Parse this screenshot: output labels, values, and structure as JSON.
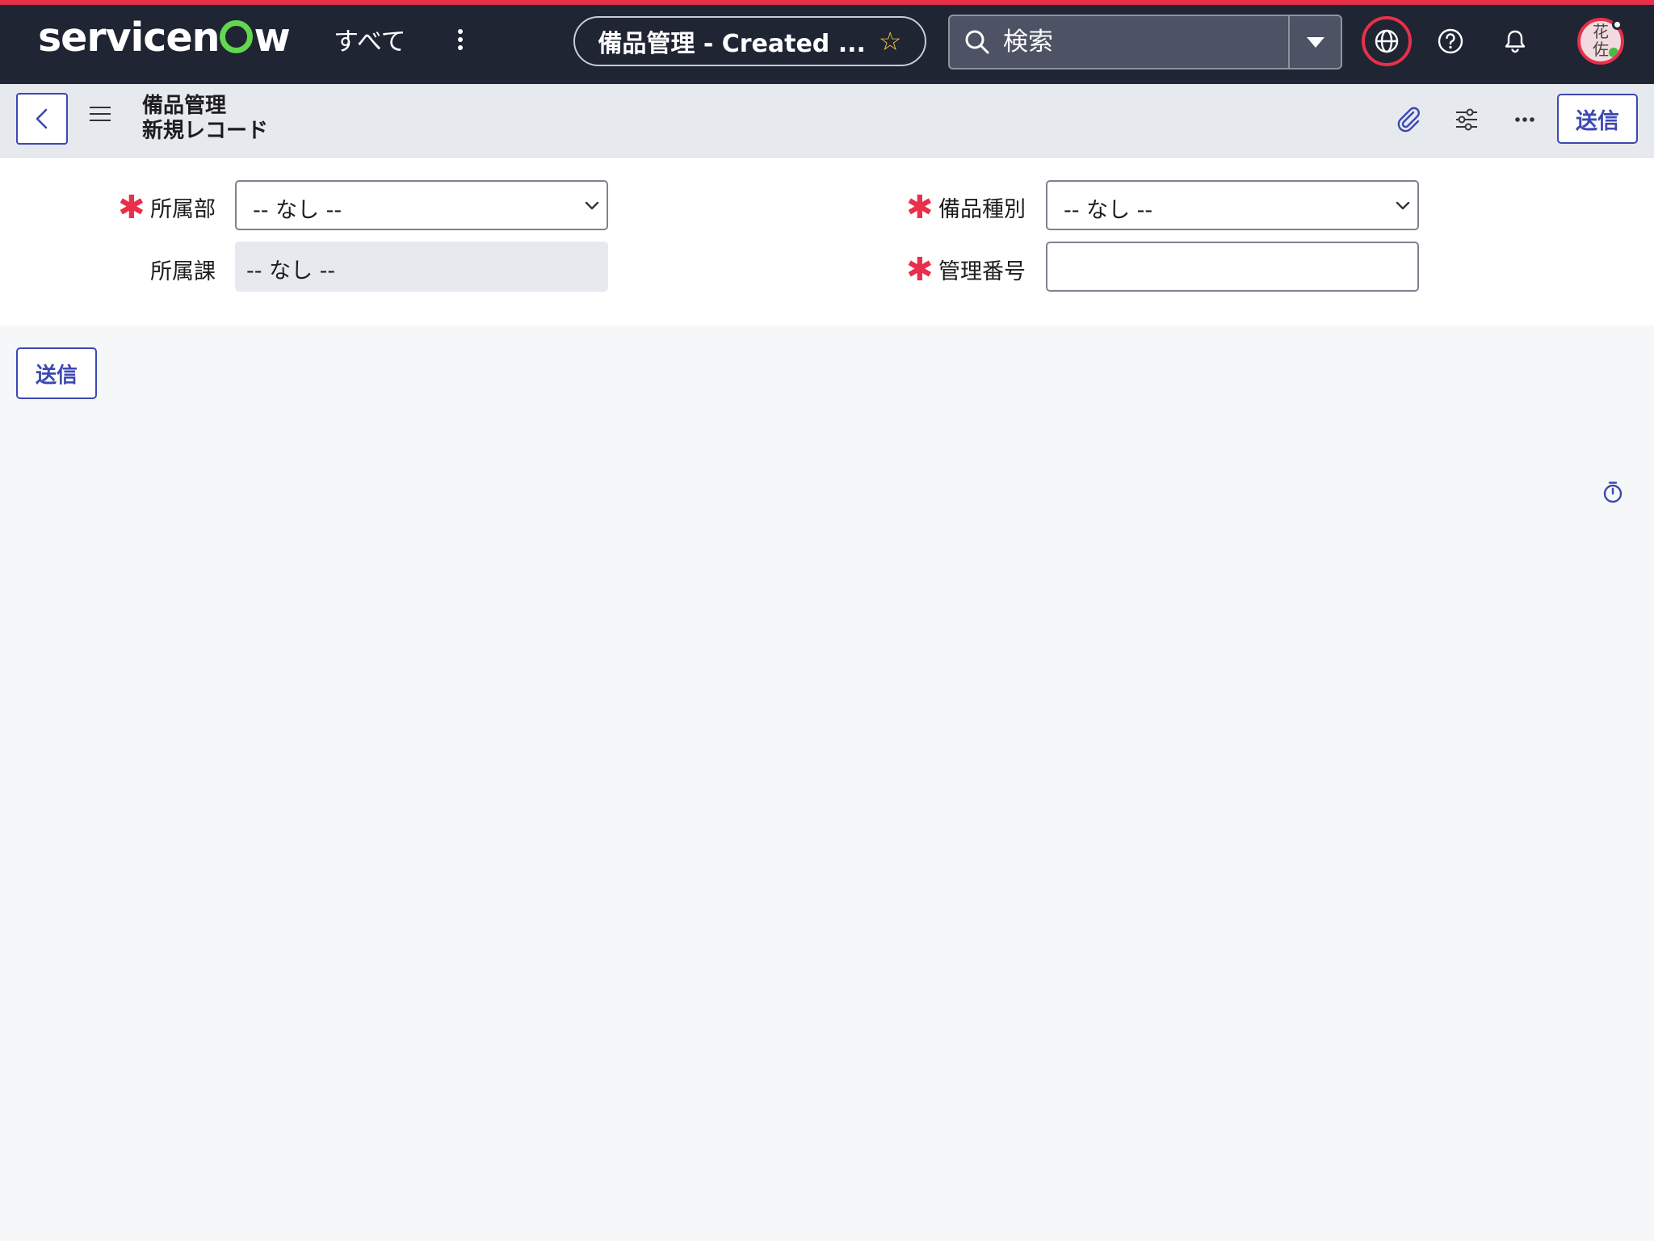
{
  "navbar": {
    "logo_pre": "servicen",
    "logo_post": "w",
    "all_menu_label": "すべて",
    "context_title": "備品管理 - Created ...",
    "search_placeholder": "検索",
    "avatar_initials_top": "花",
    "avatar_initials_bottom": "佐",
    "accent_color": "#e8304a"
  },
  "form_header": {
    "title_line1": "備品管理",
    "title_line2": "新規レコード",
    "submit_label": "送信"
  },
  "form": {
    "fields": [
      {
        "label": "所属部",
        "required": true,
        "type": "select",
        "value": "-- なし --"
      },
      {
        "label": "所属課",
        "required": false,
        "type": "readonly",
        "value": "-- なし --"
      },
      {
        "label": "備品種別",
        "required": true,
        "type": "select",
        "value": "-- なし --"
      },
      {
        "label": "管理番号",
        "required": true,
        "type": "text",
        "value": ""
      }
    ],
    "required_mark": "✱",
    "submit_label": "送信"
  }
}
